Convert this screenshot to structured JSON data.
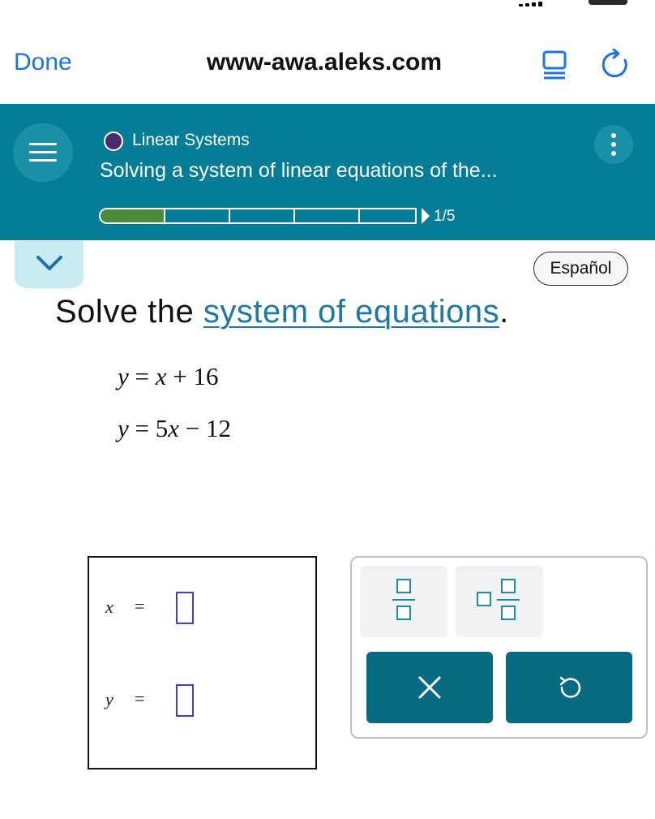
{
  "browser": {
    "done_label": "Done",
    "url": "www-awa.aleks.com"
  },
  "header": {
    "topic": "Linear Systems",
    "lesson_title": "Solving a system of linear equations of the...",
    "progress_current": 1,
    "progress_total": 5,
    "progress_text": "1/5"
  },
  "toolbar": {
    "language_label": "Español"
  },
  "question": {
    "prefix": "Solve the ",
    "link_text": "system of equations",
    "suffix": ".",
    "eq1": {
      "lhs": "y",
      "rhs_var": "x",
      "rhs_rest": "+ 16"
    },
    "eq2": {
      "lhs": "y",
      "rhs_coef": "5",
      "rhs_var": "x",
      "rhs_rest": "− 12"
    }
  },
  "answer": {
    "x_var": "x",
    "y_var": "y",
    "equals": "=",
    "x_value": "",
    "y_value": ""
  },
  "keypad": {
    "keys": [
      "fraction",
      "mixed-number",
      "clear",
      "undo"
    ]
  },
  "colors": {
    "header_teal": "#067d96",
    "progress_fill": "#4a8a3b",
    "link_blue": "#1a7aa3",
    "button_teal": "#066b80",
    "input_border": "#3a3af0"
  }
}
